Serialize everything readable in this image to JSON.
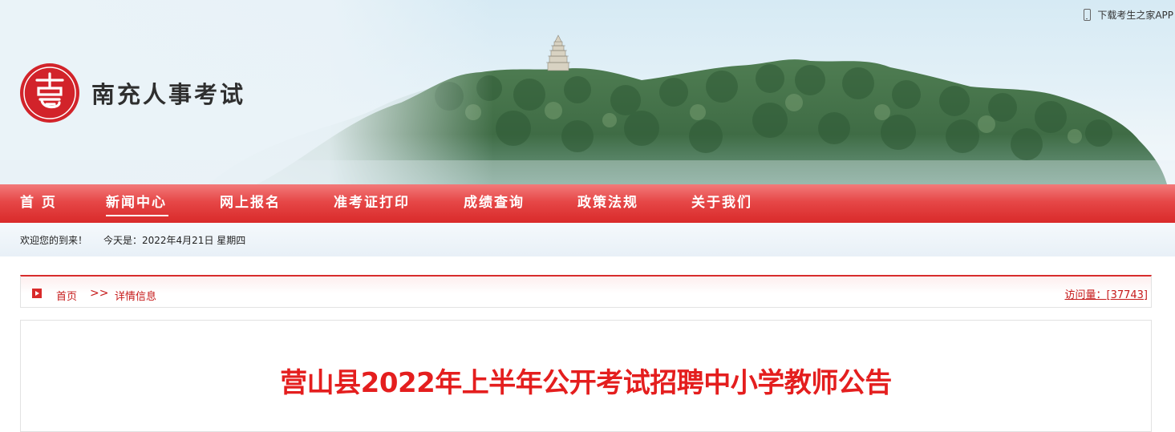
{
  "header": {
    "app_link": "下载考生之家APP",
    "site_name": "南充人事考试"
  },
  "nav": {
    "items": [
      {
        "label": "首 页"
      },
      {
        "label": "新闻中心",
        "active": true
      },
      {
        "label": "网上报名"
      },
      {
        "label": "准考证打印"
      },
      {
        "label": "成绩查询"
      },
      {
        "label": "政策法规"
      },
      {
        "label": "关于我们"
      }
    ]
  },
  "welcome": {
    "greeting": "欢迎您的到来！",
    "date": "今天是：2022年4月21日 星期四"
  },
  "breadcrumb": {
    "home": "首页",
    "separator": ">>",
    "current": "详情信息",
    "visits": "访问量：[37743]"
  },
  "article": {
    "title": "营山县2022年上半年公开考试招聘中小学教师公告"
  },
  "colors": {
    "brand_red": "#d92a2a",
    "title_red": "#e41e1e"
  }
}
